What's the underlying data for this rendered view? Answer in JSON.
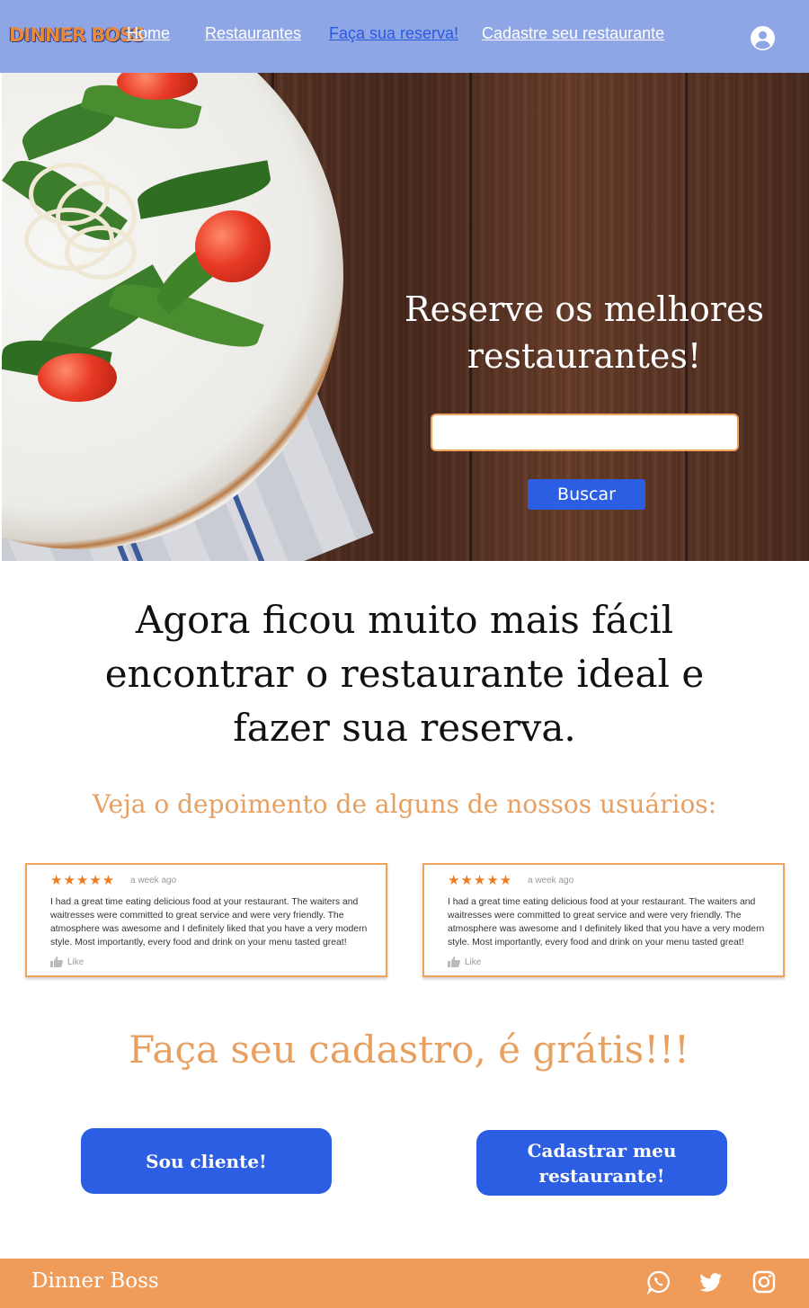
{
  "nav": {
    "logo": "DINNER BOSS",
    "links": [
      "Home",
      "Restaurantes",
      "Faça sua reserva!",
      "Cadastre seu restaurante"
    ]
  },
  "hero": {
    "title": "Reserve os melhores restaurantes!",
    "search_value": "",
    "search_button": "Buscar"
  },
  "main": {
    "headline": "Agora ficou muito mais fácil encontrar o restaurante ideal e fazer sua reserva.",
    "testimonials_title": "Veja o depoimento de alguns de nossos usuários:",
    "reviews": [
      {
        "stars": "★★★★★",
        "time": "a week ago",
        "text": "I had a great time eating delicious food at your restaurant. The waiters and waitresses were committed to great service and were very friendly. The atmosphere was awesome and I definitely liked that you have a very modern style. Most importantly, every food and drink on your menu tasted great!",
        "like": "Like"
      },
      {
        "stars": "★★★★★",
        "time": "a week ago",
        "text": "I had a great time eating delicious food at your restaurant. The waiters and waitresses were committed to great service and were very friendly. The atmosphere was awesome and I definitely liked that you have a very modern style. Most importantly, every food and drink on your menu tasted great!",
        "like": "Like"
      }
    ],
    "signup_title": "Faça seu cadastro, é grátis!!!",
    "client_button": "Sou cliente!",
    "restaurant_button": "Cadastrar meu restaurante!"
  },
  "footer": {
    "brand": "Dinner Boss",
    "icons": [
      "whatsapp-icon",
      "twitter-icon",
      "instagram-icon"
    ]
  },
  "colors": {
    "nav_bg": "#8ea6e6",
    "accent_orange": "#ef9c5a",
    "button_blue": "#2b5ee3",
    "active_link": "#2b59df"
  }
}
